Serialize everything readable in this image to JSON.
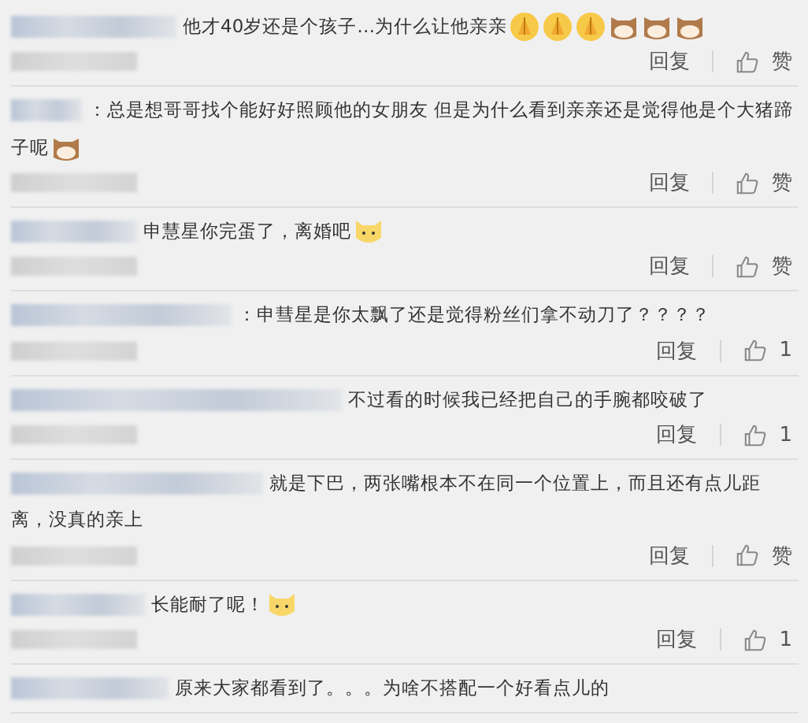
{
  "comments": [
    {
      "lines": [
        "他才40岁还是个孩子…为什么让他亲亲"
      ],
      "emojis": [
        {
          "kind": "hands"
        },
        {
          "kind": "hands"
        },
        {
          "kind": "hands"
        },
        {
          "kind": "cat"
        },
        {
          "kind": "cat"
        },
        {
          "kind": "cat"
        }
      ],
      "reply": "回复",
      "like": "赞"
    },
    {
      "lines": [
        "：总是想哥哥找个能好好照顾他的女朋友 但是为什么看到亲亲还是觉得他是个大猪蹄",
        "子呢"
      ],
      "emojis": [
        {
          "kind": "cat"
        }
      ],
      "reply": "回复",
      "like": "赞"
    },
    {
      "lines": [
        "申慧星你完蛋了，离婚吧"
      ],
      "emojis": [
        {
          "kind": "dog"
        }
      ],
      "reply": "回复",
      "like": "赞"
    },
    {
      "lines": [
        "：申彗星是你太飘了还是觉得粉丝们拿不动刀了？？？？"
      ],
      "reply": "回复",
      "like": "1"
    },
    {
      "lines": [
        "不过看的时候我已经把自己的手腕都咬破了"
      ],
      "reply": "回复",
      "like": "1"
    },
    {
      "lines": [
        "就是下巴，两张嘴根本不在同一个位置上，而且还有点儿距",
        "离，没真的亲上"
      ],
      "reply": "回复",
      "like": "赞"
    },
    {
      "lines": [
        "长能耐了呢！"
      ],
      "emojis": [
        {
          "kind": "dog"
        }
      ],
      "reply": "回复",
      "like": "1"
    },
    {
      "lines": [
        "原来大家都看到了。。。为啥不搭配一个好看点儿的"
      ]
    }
  ]
}
